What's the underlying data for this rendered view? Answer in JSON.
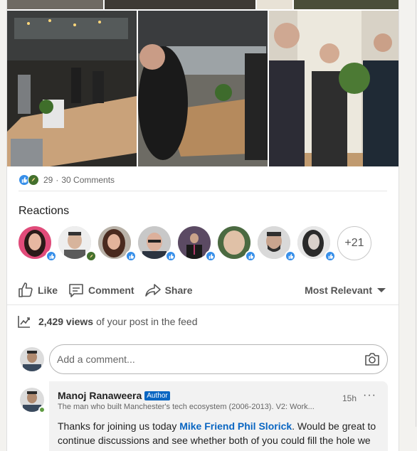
{
  "post": {
    "photo_count": 3
  },
  "social": {
    "reaction_count": "29",
    "separator": "·",
    "comments_label": "30 Comments"
  },
  "reactions": {
    "title": "Reactions",
    "more_label": "+21",
    "avatars": [
      {
        "badge": "like"
      },
      {
        "badge": "celebrate"
      },
      {
        "badge": "like"
      },
      {
        "badge": "like"
      },
      {
        "badge": "like"
      },
      {
        "badge": "like"
      },
      {
        "badge": "like"
      },
      {
        "badge": "like"
      }
    ]
  },
  "actions": {
    "like_label": "Like",
    "comment_label": "Comment",
    "share_label": "Share",
    "sort_label": "Most Relevant"
  },
  "views": {
    "count": "2,429 views",
    "suffix": "of your post in the feed"
  },
  "comment_box": {
    "placeholder": "Add a comment..."
  },
  "comment": {
    "author": "Manoj Ranaweera",
    "author_badge": "Author",
    "headline": "The man who built Manchester's tech ecosystem (2006-2013). V2: Work...",
    "time": "15h",
    "more": "···",
    "text_before": "Thanks for joining us today ",
    "mention": "Mike Friend Phil Slorick",
    "text_after": ". Would be great to continue discussions and see whether both of you could fill the hole we have in MARKETING"
  },
  "colors": {
    "like": "#378fe9",
    "celebrate": "#44712e",
    "link": "#0a66c2"
  },
  "icons": [
    "like-reaction-icon",
    "celebrate-reaction-icon",
    "thumbs-up-icon",
    "comment-icon",
    "share-icon",
    "caret-down-icon",
    "chart-trend-icon",
    "camera-icon"
  ]
}
